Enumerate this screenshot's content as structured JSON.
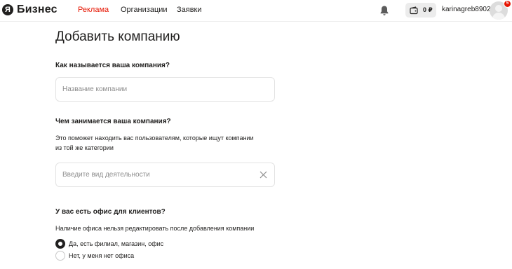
{
  "header": {
    "logo_ya": "Я",
    "logo_text": "Бизнес",
    "nav": [
      {
        "label": "Реклама",
        "active": true
      },
      {
        "label": "Организации",
        "active": false
      },
      {
        "label": "Заявки",
        "active": false
      }
    ],
    "wallet_amount": "0 ₽",
    "username": "karinagreb8902",
    "notification_count": "5",
    "icons": [
      "bell-icon",
      "wallet-icon",
      "avatar"
    ],
    "accent_color": "#e61400"
  },
  "form": {
    "title": "Добавить компанию",
    "name_section": {
      "heading": "Как называется ваша компания?",
      "placeholder": "Название компании",
      "value": ""
    },
    "activity_section": {
      "heading": "Чем занимается ваша компания?",
      "helper_line1": "Это поможет находить вас пользователям, которые ищут компании",
      "helper_line2": "из той же категории",
      "placeholder": "Введите вид деятельности",
      "value": ""
    },
    "office_section": {
      "heading": "У вас есть офис для клиентов?",
      "helper": "Наличие офиса нельзя редактировать после добавления компании",
      "options": [
        {
          "label": "Да, есть филиал, магазин, офис",
          "checked": true
        },
        {
          "label": "Нет, у меня нет офиса",
          "checked": false
        }
      ]
    }
  }
}
